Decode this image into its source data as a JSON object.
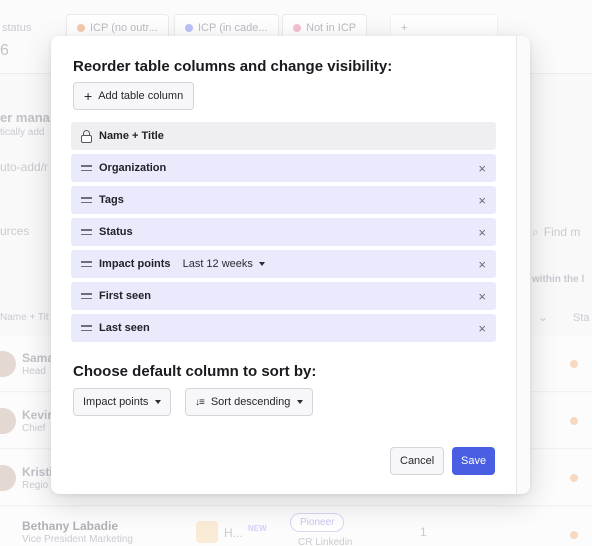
{
  "background": {
    "status_label": "status",
    "status_value": "6",
    "chips": [
      "ICP (no outr...",
      "ICP (in cade...",
      "Not in ICP"
    ],
    "chip_colors": [
      "#f3b48a",
      "#9fa9f5",
      "#f2a5c4"
    ],
    "add_chip": "+",
    "manager_heading": "er mana",
    "manager_sub": "tically add",
    "auto_add": "uto-add/r",
    "sources": "urces",
    "search_placeholder": "Find m",
    "within": "within the l",
    "name_title_header": "Name + Tit",
    "status_header": "Sta",
    "rows": [
      {
        "name": "Sama",
        "sub": "Head"
      },
      {
        "name": "Kevir",
        "sub": "Chief"
      },
      {
        "name": "Kristi",
        "sub": "Regio"
      }
    ],
    "last_row": {
      "name": "Bethany Labadie",
      "sub": "Vice President Marketing",
      "company": "H...",
      "new_tag": "NEW",
      "stage": "Pioneer",
      "source": "CR Linkedin",
      "count": "1"
    }
  },
  "modal": {
    "title": "Reorder table columns and change visibility:",
    "add_column_label": "Add table column",
    "columns": [
      {
        "label": "Name + Title"
      },
      {
        "label": "Organization"
      },
      {
        "label": "Tags"
      },
      {
        "label": "Status"
      },
      {
        "label": "Impact points",
        "sub_value": "Last 12 weeks"
      },
      {
        "label": "First seen"
      },
      {
        "label": "Last seen"
      }
    ],
    "remove_glyph": "×",
    "sort_title": "Choose default column to sort by:",
    "sort_column": "Impact points",
    "sort_direction": "Sort descending",
    "cancel_label": "Cancel",
    "save_label": "Save"
  },
  "colors": {
    "accent": "#4a5ee3",
    "row_bg": "#e9eafb",
    "locked_row_bg": "#efeff2"
  }
}
